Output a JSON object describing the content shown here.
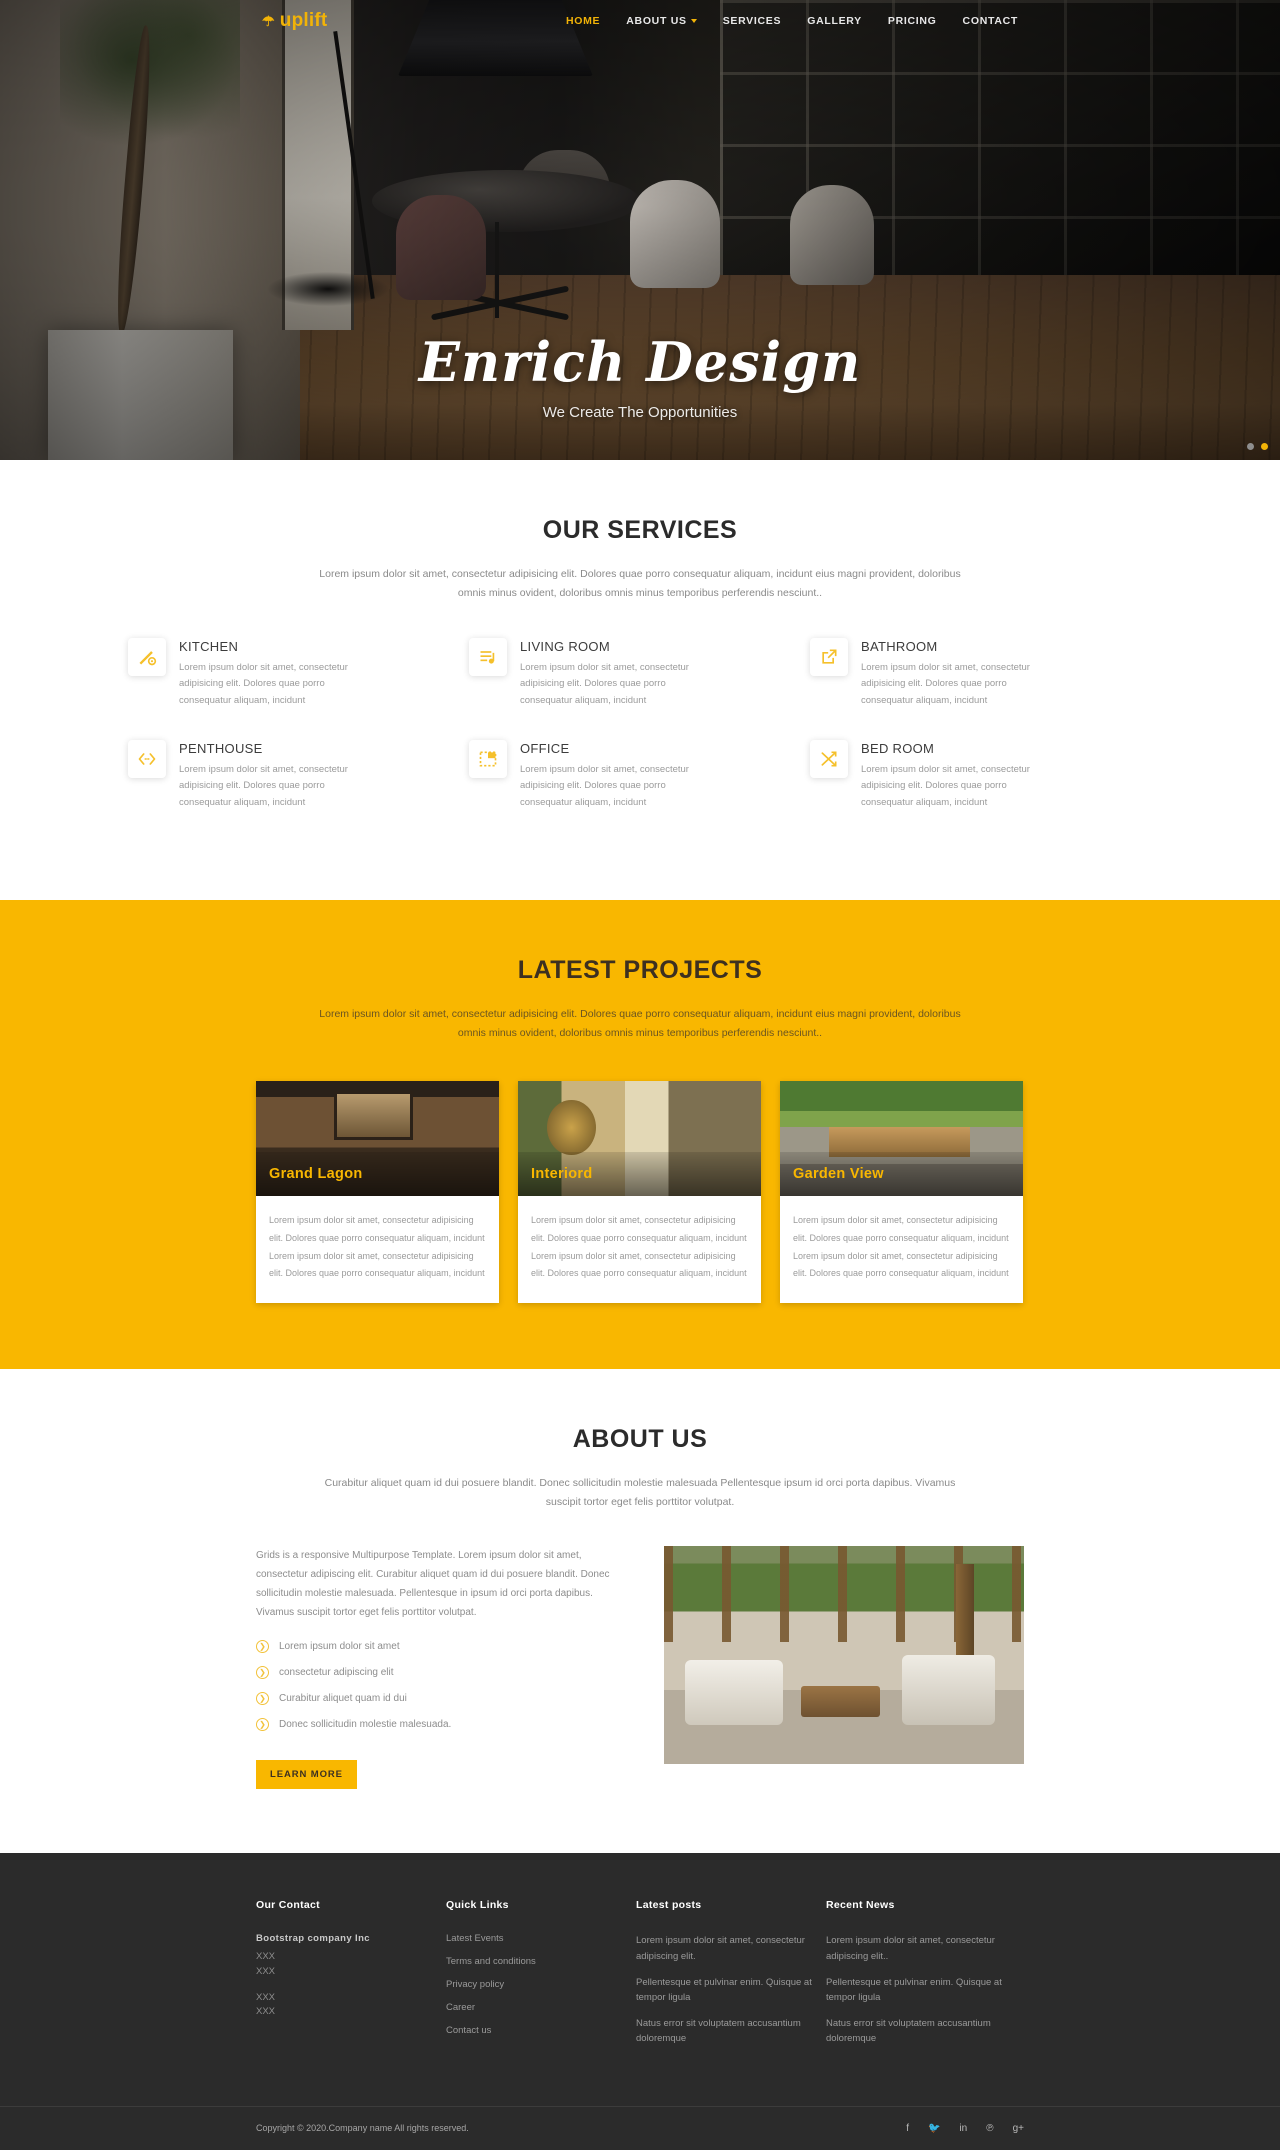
{
  "nav": {
    "brand": "uplift",
    "brand_icon": "umbrella-icon",
    "items": [
      {
        "label": "HOME",
        "active": true
      },
      {
        "label": "ABOUT US",
        "active": false,
        "dropdown": true
      },
      {
        "label": "SERVICES",
        "active": false
      },
      {
        "label": "GALLERY",
        "active": false
      },
      {
        "label": "PRICING",
        "active": false
      },
      {
        "label": "CONTACT",
        "active": false
      }
    ]
  },
  "hero": {
    "title": "Enrich Design",
    "subtitle": "We Create The Opportunities",
    "dots": 2,
    "active_dot": 1
  },
  "services": {
    "title": "OUR SERVICES",
    "lead": "Lorem ipsum dolor sit amet, consectetur adipisicing elit. Dolores quae porro consequatur aliquam, incidunt eius magni provident, doloribus omnis minus ovident, doloribus omnis minus temporibus perferendis nesciunt..",
    "items": [
      {
        "title": "KITCHEN",
        "icon": "ruler-gear-icon",
        "text": "Lorem ipsum dolor sit amet, consectetur adipisicing elit. Dolores quae porro consequatur aliquam, incidunt"
      },
      {
        "title": "LIVING ROOM",
        "icon": "playlist-music-icon",
        "text": "Lorem ipsum dolor sit amet, consectetur adipisicing elit. Dolores quae porro consequatur aliquam, incidunt"
      },
      {
        "title": "BATHROOM",
        "icon": "external-link-icon",
        "text": "Lorem ipsum dolor sit amet, consectetur adipisicing elit. Dolores quae porro consequatur aliquam, incidunt"
      },
      {
        "title": "PENTHOUSE",
        "icon": "code-brackets-icon",
        "text": "Lorem ipsum dolor sit amet, consectetur adipisicing elit. Dolores quae porro consequatur aliquam, incidunt"
      },
      {
        "title": "OFFICE",
        "icon": "dashed-box-icon",
        "text": "Lorem ipsum dolor sit amet, consectetur adipisicing elit. Dolores quae porro consequatur aliquam, incidunt"
      },
      {
        "title": "BED ROOM",
        "icon": "shuffle-arrows-icon",
        "text": "Lorem ipsum dolor sit amet, consectetur adipisicing elit. Dolores quae porro consequatur aliquam, incidunt"
      }
    ]
  },
  "projects": {
    "title": "LATEST PROJECTS",
    "lead": "Lorem ipsum dolor sit amet, consectetur adipisicing elit. Dolores quae porro consequatur aliquam, incidunt eius magni provident, doloribus omnis minus ovident, doloribus omnis minus temporibus perferendis nesciunt..",
    "bg_color": "#f9b700",
    "cards": [
      {
        "caption": "Grand Lagon",
        "text": "Lorem ipsum dolor sit amet, consectetur adipisicing elit. Dolores quae porro consequatur aliquam, incidunt Lorem ipsum dolor sit amet, consectetur adipisicing elit. Dolores quae porro consequatur aliquam, incidunt"
      },
      {
        "caption": "Interiord",
        "text": "Lorem ipsum dolor sit amet, consectetur adipisicing elit. Dolores quae porro consequatur aliquam, incidunt Lorem ipsum dolor sit amet, consectetur adipisicing elit. Dolores quae porro consequatur aliquam, incidunt"
      },
      {
        "caption": "Garden View",
        "text": "Lorem ipsum dolor sit amet, consectetur adipisicing elit. Dolores quae porro consequatur aliquam, incidunt Lorem ipsum dolor sit amet, consectetur adipisicing elit. Dolores quae porro consequatur aliquam, incidunt"
      }
    ]
  },
  "about": {
    "title": "ABOUT US",
    "lead": "Curabitur aliquet quam id dui posuere blandit. Donec sollicitudin molestie malesuada Pellentesque ipsum id orci porta dapibus. Vivamus suscipit tortor eget felis porttitor volutpat.",
    "paragraph": "Grids is a responsive Multipurpose Template. Lorem ipsum dolor sit amet, consectetur adipiscing elit. Curabitur aliquet quam id dui posuere blandit. Donec sollicitudin molestie malesuada. Pellentesque in ipsum id orci porta dapibus. Vivamus suscipit tortor eget felis porttitor volutpat.",
    "bullets": [
      "Lorem ipsum dolor sit amet",
      "consectetur adipiscing elit",
      "Curabitur aliquet quam id dui",
      "Donec sollicitudin molestie malesuada."
    ],
    "button": "LEARN MORE"
  },
  "footer": {
    "contact": {
      "heading": "Our Contact",
      "company": "Bootstrap company Inc",
      "lines_a": [
        "XXX",
        "XXX"
      ],
      "lines_b": [
        "XXX",
        "XXX"
      ]
    },
    "quick_links": {
      "heading": "Quick Links",
      "items": [
        "Latest Events",
        "Terms and conditions",
        "Privacy policy",
        "Career",
        "Contact us"
      ]
    },
    "latest_posts": {
      "heading": "Latest posts",
      "items": [
        "Lorem ipsum dolor sit amet, consectetur adipiscing elit.",
        "Pellentesque et pulvinar enim. Quisque at tempor ligula",
        "Natus error sit voluptatem accusantium doloremque"
      ]
    },
    "recent_news": {
      "heading": "Recent News",
      "items": [
        "Lorem ipsum dolor sit amet, consectetur adipiscing elit..",
        "Pellentesque et pulvinar enim. Quisque at tempor ligula",
        "Natus error sit voluptatem accusantium doloremque"
      ]
    },
    "copyright": "Copyright © 2020.Company name All rights reserved.",
    "social": [
      {
        "name": "facebook-icon",
        "glyph": "f"
      },
      {
        "name": "twitter-icon",
        "glyph": "🐦"
      },
      {
        "name": "linkedin-icon",
        "glyph": "in"
      },
      {
        "name": "pinterest-icon",
        "glyph": "℗"
      },
      {
        "name": "google-plus-icon",
        "glyph": "g+"
      }
    ]
  }
}
